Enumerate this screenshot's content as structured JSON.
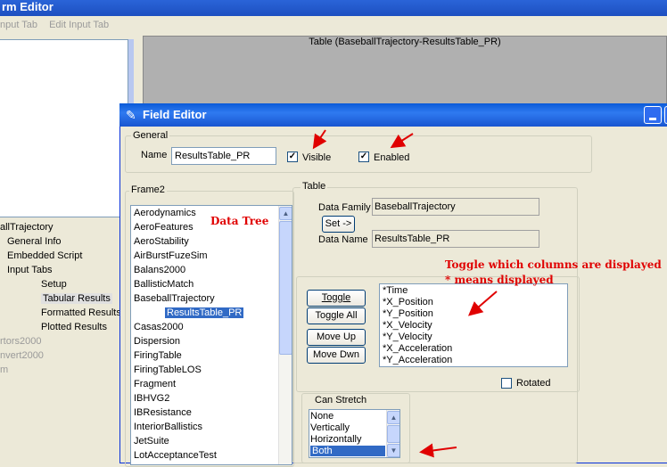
{
  "background_window": {
    "title": "rm Editor",
    "menu": [
      "nput Tab",
      "Edit Input Tab"
    ],
    "table_caption": "Table (BaseballTrajectory-ResultsTable_PR)",
    "tree": [
      {
        "label": "allTrajectory",
        "gray": false
      },
      {
        "label": "General Info",
        "gray": false
      },
      {
        "label": "Embedded Script",
        "gray": false
      },
      {
        "label": "Input Tabs",
        "gray": false
      },
      {
        "label": "Setup",
        "gray": false
      },
      {
        "label": "Tabular Results",
        "gray": false
      },
      {
        "label": "Formatted Results",
        "gray": false
      },
      {
        "label": "Plotted Results",
        "gray": false
      },
      {
        "label": "rtors2000",
        "gray": true
      },
      {
        "label": "nvert2000",
        "gray": true
      },
      {
        "label": "m",
        "gray": true
      }
    ]
  },
  "field_editor": {
    "title": "Field Editor",
    "general": {
      "group_label": "General",
      "name_label": "Name",
      "name_value": "ResultsTable_PR",
      "visible_label": "Visible",
      "visible_checked": true,
      "enabled_label": "Enabled",
      "enabled_checked": true
    },
    "frame2": {
      "group_label": "Frame2",
      "items": [
        "Aerodynamics",
        "AeroFeatures",
        "AeroStability",
        "AirBurstFuzeSim",
        "Balans2000",
        "BallisticMatch",
        "BaseballTrajectory",
        "ResultsTable_PR",
        "Casas2000",
        "Dispersion",
        "FiringTable",
        "FiringTableLOS",
        "Fragment",
        "IBHVG2",
        "IBResistance",
        "InteriorBallistics",
        "JetSuite",
        "LotAcceptanceTest"
      ],
      "selected_index": 7
    },
    "table": {
      "group_label": "Table",
      "data_family_label": "Data Family",
      "data_family_value": "BaseballTrajectory",
      "set_button": "Set ->",
      "data_name_label": "Data Name",
      "data_name_value": "ResultsTable_PR",
      "buttons": {
        "toggle": "Toggle",
        "toggle_all": "Toggle All",
        "move_up": "Move Up",
        "move_down": "Move Dwn"
      },
      "columns": [
        "*Time",
        "*X_Position",
        "*Y_Position",
        "*X_Velocity",
        "*Y_Velocity",
        "*X_Acceleration",
        "*Y_Acceleration"
      ],
      "rotated_label": "Rotated",
      "rotated_checked": false
    },
    "can_stretch": {
      "group_label": "Can Stretch",
      "options": [
        "None",
        "Vertically",
        "Horizontally",
        "Both"
      ],
      "selected": "Both"
    }
  },
  "annotations": {
    "data_tree": "Data Tree",
    "toggle_note_line1": "Toggle which columns are displayed",
    "toggle_note_line2": "* means displayed"
  },
  "colors": {
    "annotation": "#e00000",
    "selection": "#316ac5",
    "titlebar": "#0a5ad8"
  }
}
